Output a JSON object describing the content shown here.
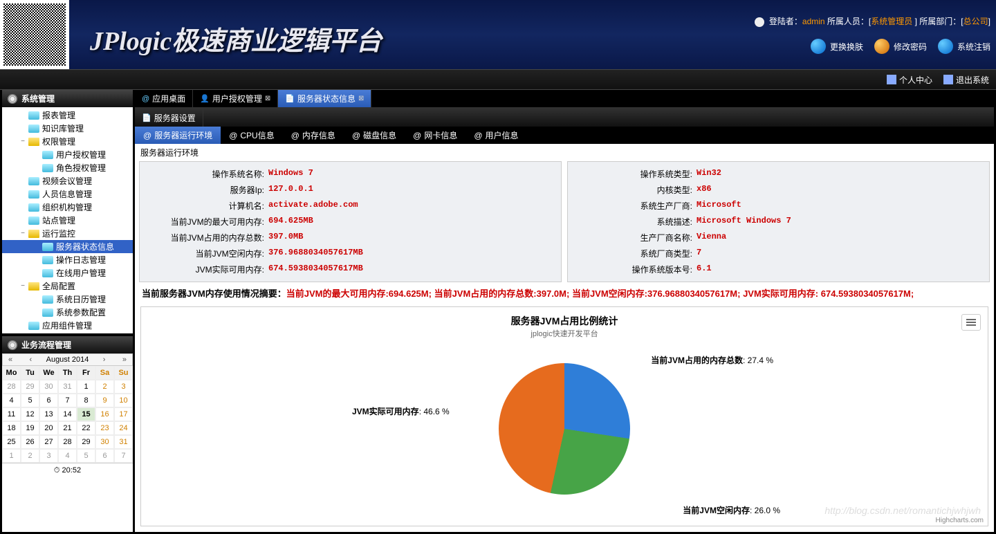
{
  "header": {
    "logo": "JPlogic极速商业逻辑平台",
    "login_label": "登陆者：",
    "login_user": "admin",
    "member_label": " 所属人员：[",
    "member_value": "系统管理员",
    "dept_label": "] 所属部门：[",
    "dept_value": "总公司",
    "close_bracket": "]",
    "btn_skin": "更换换肤",
    "btn_pwd": "修改密码",
    "btn_logout": "系统注销"
  },
  "toolbar": {
    "personal": "个人中心",
    "exit": "退出系统"
  },
  "sidebar": {
    "group1": "系统管理",
    "group2": "业务流程管理",
    "items": [
      {
        "label": "报表管理",
        "lvl": 1,
        "ico": "doc"
      },
      {
        "label": "知识库管理",
        "lvl": 1,
        "ico": "doc"
      },
      {
        "label": "权限管理",
        "lvl": 1,
        "ico": "folder",
        "exp": "−"
      },
      {
        "label": "用户授权管理",
        "lvl": 2,
        "ico": "doc"
      },
      {
        "label": "角色授权管理",
        "lvl": 2,
        "ico": "doc"
      },
      {
        "label": "视频会议管理",
        "lvl": 1,
        "ico": "doc"
      },
      {
        "label": "人员信息管理",
        "lvl": 1,
        "ico": "doc"
      },
      {
        "label": "组织机构管理",
        "lvl": 1,
        "ico": "doc"
      },
      {
        "label": "站点管理",
        "lvl": 1,
        "ico": "doc"
      },
      {
        "label": "运行监控",
        "lvl": 1,
        "ico": "folder",
        "exp": "−"
      },
      {
        "label": "服务器状态信息",
        "lvl": 2,
        "ico": "doc",
        "sel": true
      },
      {
        "label": "操作日志管理",
        "lvl": 2,
        "ico": "doc"
      },
      {
        "label": "在线用户管理",
        "lvl": 2,
        "ico": "doc"
      },
      {
        "label": "全局配置",
        "lvl": 1,
        "ico": "folder",
        "exp": "−"
      },
      {
        "label": "系统日历管理",
        "lvl": 2,
        "ico": "doc"
      },
      {
        "label": "系统参数配置",
        "lvl": 2,
        "ico": "doc"
      },
      {
        "label": "应用组件管理",
        "lvl": 1,
        "ico": "doc"
      }
    ]
  },
  "calendar": {
    "title": "August 2014",
    "headers": [
      "Mo",
      "Tu",
      "We",
      "Th",
      "Fr",
      "Sa",
      "Su"
    ],
    "weeks": [
      [
        {
          "d": 28,
          "o": 1
        },
        {
          "d": 29,
          "o": 1
        },
        {
          "d": 30,
          "o": 1
        },
        {
          "d": 31,
          "o": 1
        },
        {
          "d": 1
        },
        {
          "d": 2,
          "w": 1
        },
        {
          "d": 3,
          "w": 1
        }
      ],
      [
        {
          "d": 4
        },
        {
          "d": 5
        },
        {
          "d": 6
        },
        {
          "d": 7
        },
        {
          "d": 8
        },
        {
          "d": 9,
          "w": 1
        },
        {
          "d": 10,
          "w": 1
        }
      ],
      [
        {
          "d": 11
        },
        {
          "d": 12
        },
        {
          "d": 13
        },
        {
          "d": 14
        },
        {
          "d": 15,
          "t": 1
        },
        {
          "d": 16,
          "w": 1
        },
        {
          "d": 17,
          "w": 1
        }
      ],
      [
        {
          "d": 18
        },
        {
          "d": 19
        },
        {
          "d": 20
        },
        {
          "d": 21
        },
        {
          "d": 22
        },
        {
          "d": 23,
          "w": 1
        },
        {
          "d": 24,
          "w": 1
        }
      ],
      [
        {
          "d": 25
        },
        {
          "d": 26
        },
        {
          "d": 27
        },
        {
          "d": 28
        },
        {
          "d": 29
        },
        {
          "d": 30,
          "w": 1
        },
        {
          "d": 31,
          "w": 1
        }
      ],
      [
        {
          "d": 1,
          "o": 1
        },
        {
          "d": 2,
          "o": 1
        },
        {
          "d": 3,
          "o": 1
        },
        {
          "d": 4,
          "o": 1
        },
        {
          "d": 5,
          "o": 1
        },
        {
          "d": 6,
          "o": 1,
          "w": 1
        },
        {
          "d": 7,
          "o": 1,
          "w": 1
        }
      ]
    ],
    "time": "20:52"
  },
  "tabs_top": [
    {
      "label": "应用桌面",
      "icon": "@"
    },
    {
      "label": "用户授权管理",
      "icon": "👤",
      "close": true
    },
    {
      "label": "服务器状态信息",
      "icon": "📄",
      "close": true,
      "active": true
    }
  ],
  "tabs_mid": [
    {
      "label": "服务器设置",
      "icon": "📄"
    }
  ],
  "tabs_sub": [
    {
      "label": "服务器运行环境",
      "active": true
    },
    {
      "label": "CPU信息"
    },
    {
      "label": "内存信息"
    },
    {
      "label": "磁盘信息"
    },
    {
      "label": "网卡信息"
    },
    {
      "label": "用户信息"
    }
  ],
  "panel": {
    "title": "服务器运行环境",
    "left": [
      {
        "label": "操作系统名称:",
        "value": "Windows 7"
      },
      {
        "label": "服务器Ip:",
        "value": "127.0.0.1"
      },
      {
        "label": "计算机名:",
        "value": "activate.adobe.com"
      },
      {
        "label": "当前JVM的最大可用内存:",
        "value": "694.625MB"
      },
      {
        "label": "当前JVM占用的内存总数:",
        "value": "397.0MB"
      },
      {
        "label": "当前JVM空闲内存:",
        "value": "376.9688034057617MB"
      },
      {
        "label": "JVM实际可用内存:",
        "value": "674.5938034057617MB"
      }
    ],
    "right": [
      {
        "label": "操作系统类型:",
        "value": "Win32"
      },
      {
        "label": "内核类型:",
        "value": "x86"
      },
      {
        "label": "系统生产厂商:",
        "value": "Microsoft"
      },
      {
        "label": "系统描述:",
        "value": "Microsoft Windows 7"
      },
      {
        "label": "生产厂商名称:",
        "value": "Vienna"
      },
      {
        "label": "系统厂商类型:",
        "value": "7"
      },
      {
        "label": "操作系统版本号:",
        "value": "6.1"
      }
    ]
  },
  "summary": {
    "prefix": "当前服务器JVM内存使用情况摘要：",
    "parts": [
      {
        "k": "当前JVM的最大可用内存",
        "v": ":694.625M; "
      },
      {
        "k": "当前JVM占用的内存总数",
        "v": ":397.0M; "
      },
      {
        "k": "当前JVM空闲内存",
        "v": ":376.9688034057617M; "
      },
      {
        "k": "JVM实际可用内存",
        "v": ": 674.5938034057617M;"
      }
    ]
  },
  "chart": {
    "title": "服务器JVM占用比例统计",
    "subtitle": "jplogic快速开发平台",
    "credit": "Highcharts.com",
    "labels": {
      "used": "当前JVM占用的内存总数",
      "free": "当前JVM空闲内存",
      "actual": "JVM实际可用内存"
    },
    "percents": {
      "used": "27.4 %",
      "free": "26.0 %",
      "actual": "46.6 %"
    }
  },
  "watermark": "http://blog.csdn.net/romantichjwhjwh",
  "chart_data": {
    "type": "pie",
    "title": "服务器JVM占用比例统计",
    "subtitle": "jplogic快速开发平台",
    "series": [
      {
        "name": "当前JVM占用的内存总数",
        "value": 27.4,
        "color": "#2f7ed8"
      },
      {
        "name": "当前JVM空闲内存",
        "value": 26.0,
        "color": "#47a447"
      },
      {
        "name": "JVM实际可用内存",
        "value": 46.6,
        "color": "#e66b1e"
      }
    ]
  }
}
